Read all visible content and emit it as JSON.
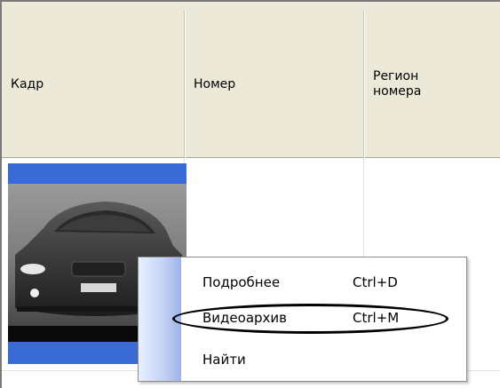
{
  "table": {
    "columns": [
      {
        "key": "frame",
        "label": "Кадр"
      },
      {
        "key": "number",
        "label": "Номер"
      },
      {
        "key": "region",
        "label": "Регион\nномера"
      }
    ]
  },
  "context_menu": {
    "items": [
      {
        "label": "Подробнее",
        "shortcut": "Ctrl+D"
      },
      {
        "label": "Видеоархив",
        "shortcut": "Ctrl+M",
        "highlighted": true
      },
      {
        "label": "Найти",
        "shortcut": ""
      }
    ]
  },
  "colors": {
    "header_bg": "#ece9d8",
    "selection": "#3a6ad4",
    "menu_stripe": "#9db4e8",
    "highlight_outline": "#000000"
  },
  "icons": [
    "car-frame-thumbnail"
  ]
}
